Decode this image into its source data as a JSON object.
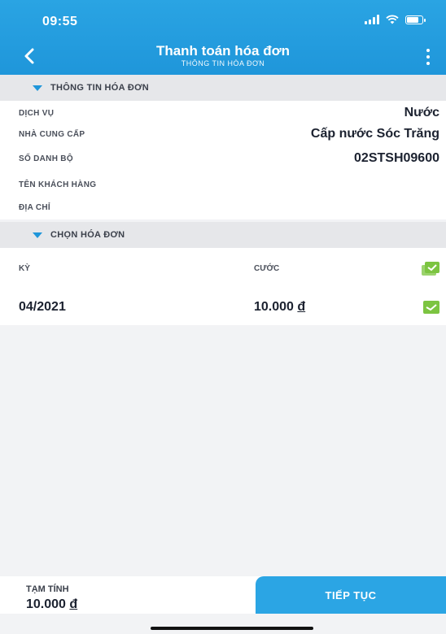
{
  "status_bar": {
    "time": "09:55"
  },
  "header": {
    "title": "Thanh toán hóa đơn",
    "subtitle": "THÔNG TIN HÓA ĐƠN"
  },
  "invoice_info": {
    "section_title": "THÔNG TIN HÓA ĐƠN",
    "rows": [
      {
        "label": "DỊCH VỤ",
        "value": "Nước"
      },
      {
        "label": "NHÀ CUNG CẤP",
        "value": "Cấp nước Sóc Trăng"
      },
      {
        "label": "SỐ DANH BỘ",
        "value": "02STSH09600"
      },
      {
        "label": "TÊN KHÁCH HÀNG",
        "value": ""
      },
      {
        "label": "ĐỊA CHỈ",
        "value": ""
      }
    ]
  },
  "bill_select": {
    "section_title": "CHỌN HÓA ĐƠN",
    "col_period": "KỲ",
    "col_fee": "CƯỚC",
    "bills": [
      {
        "period": "04/2021",
        "amount": "10.000",
        "currency": "đ"
      }
    ]
  },
  "footer": {
    "total_label": "TẠM TÍNH",
    "total_value": "10.000",
    "currency": "đ",
    "continue_label": "TIẾP TỤC"
  },
  "colors": {
    "brand_blue": "#1f96da",
    "check_green": "#7cc441"
  }
}
